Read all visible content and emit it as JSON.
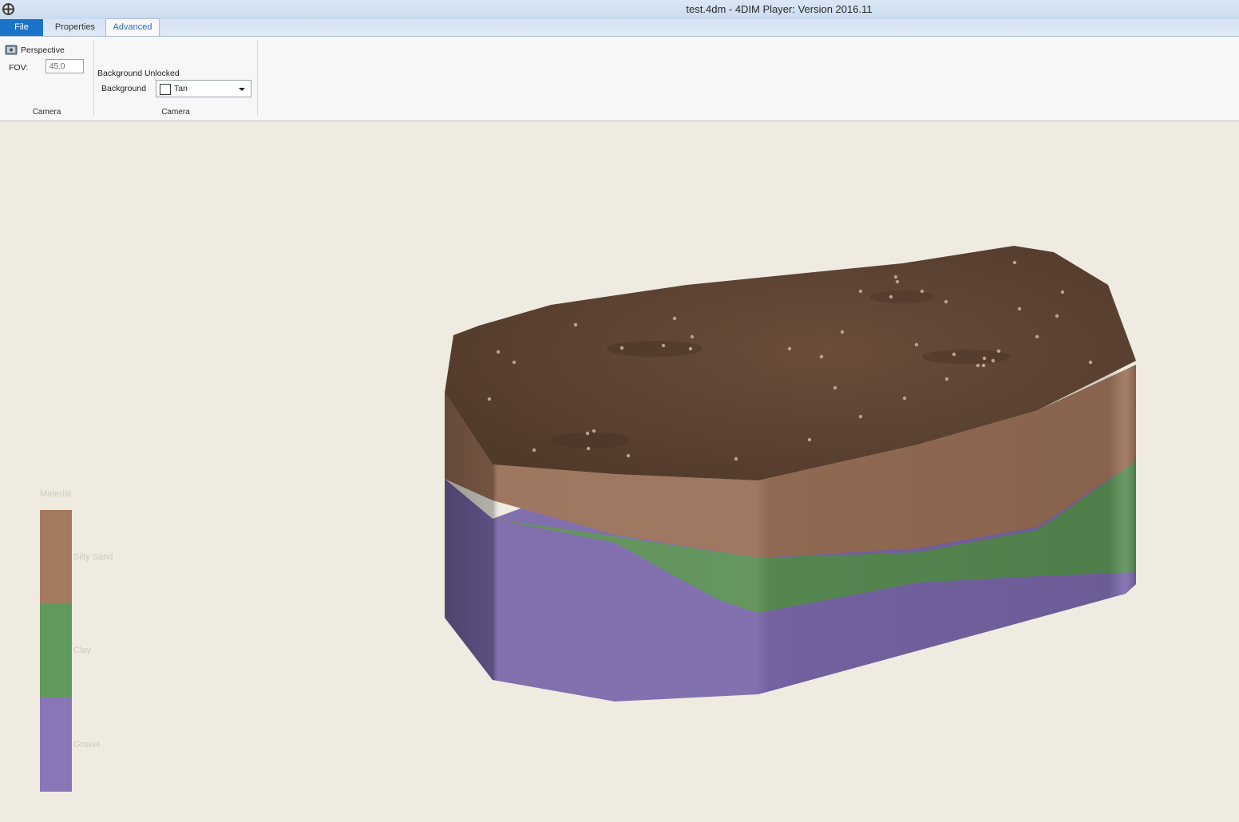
{
  "window": {
    "title": "test.4dm - 4DIM Player: Version 2016.11"
  },
  "tabs": {
    "file": "File",
    "properties": "Properties",
    "advanced": "Advanced"
  },
  "ribbon": {
    "perspective_label": "Perspective",
    "fov_label": "FOV:",
    "fov_value": "45.0",
    "camera_group_label": "Camera",
    "background_unlocked": "Background Unlocked",
    "background_label": "Background",
    "background_value": "Tan",
    "background_group_label": "Camera"
  },
  "legend": {
    "title": "Material",
    "items": [
      {
        "label": "Silty Sand",
        "color": "#a47a5e"
      },
      {
        "label": "Clay",
        "color": "#5f9a5a"
      },
      {
        "label": "Gravel",
        "color": "#8a75b7"
      }
    ]
  },
  "colors": {
    "viewport_background": "#efebe1",
    "topsoil": "#5c4232",
    "silty_sand": "#9a7058",
    "clay": "#5b8f55",
    "gravel": "#7b68aa",
    "accent": "#1b74c8"
  },
  "icons": {
    "app": "app-logo-icon",
    "perspective": "camera-icon"
  }
}
